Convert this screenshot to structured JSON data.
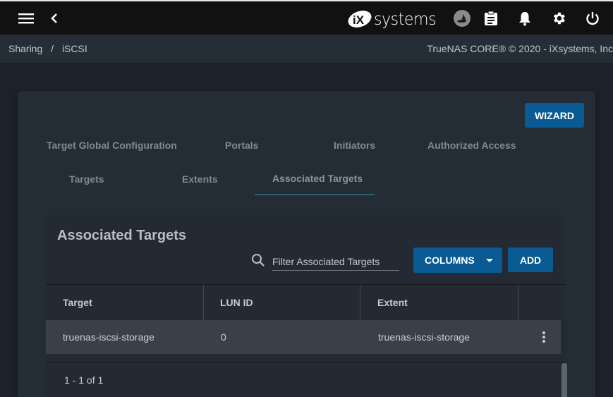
{
  "topbar": {
    "logo_text": "systems",
    "icons": [
      "menu-icon",
      "back-icon",
      "truenas-icon",
      "tasks-icon",
      "bell-icon",
      "gear-icon",
      "power-icon"
    ]
  },
  "breadcrumb": {
    "items": [
      "Sharing",
      "/",
      "iSCSI"
    ],
    "copyright": "TrueNAS CORE® © 2020 - iXsystems, Inc"
  },
  "page": {
    "wizard_label": "WIZARD",
    "tabs": [
      {
        "label": "Target Global Configuration"
      },
      {
        "label": "Portals"
      },
      {
        "label": "Initiators"
      },
      {
        "label": "Authorized Access"
      },
      {
        "label": "Targets"
      },
      {
        "label": "Extents"
      },
      {
        "label": "Associated Targets",
        "active": true
      }
    ]
  },
  "table": {
    "title": "Associated Targets",
    "filter_placeholder": "Filter Associated Targets",
    "filter_value": "",
    "columns_label": "COLUMNS",
    "add_label": "ADD",
    "headers": [
      "Target",
      "LUN ID",
      "Extent"
    ],
    "rows": [
      {
        "target": "truenas-iscsi-storage",
        "lun_id": "0",
        "extent": "truenas-iscsi-storage"
      }
    ],
    "paginator": "1 - 1 of 1"
  },
  "colors": {
    "accent": "#0a5a94",
    "topbar": "#111111",
    "card": "#242c35"
  }
}
